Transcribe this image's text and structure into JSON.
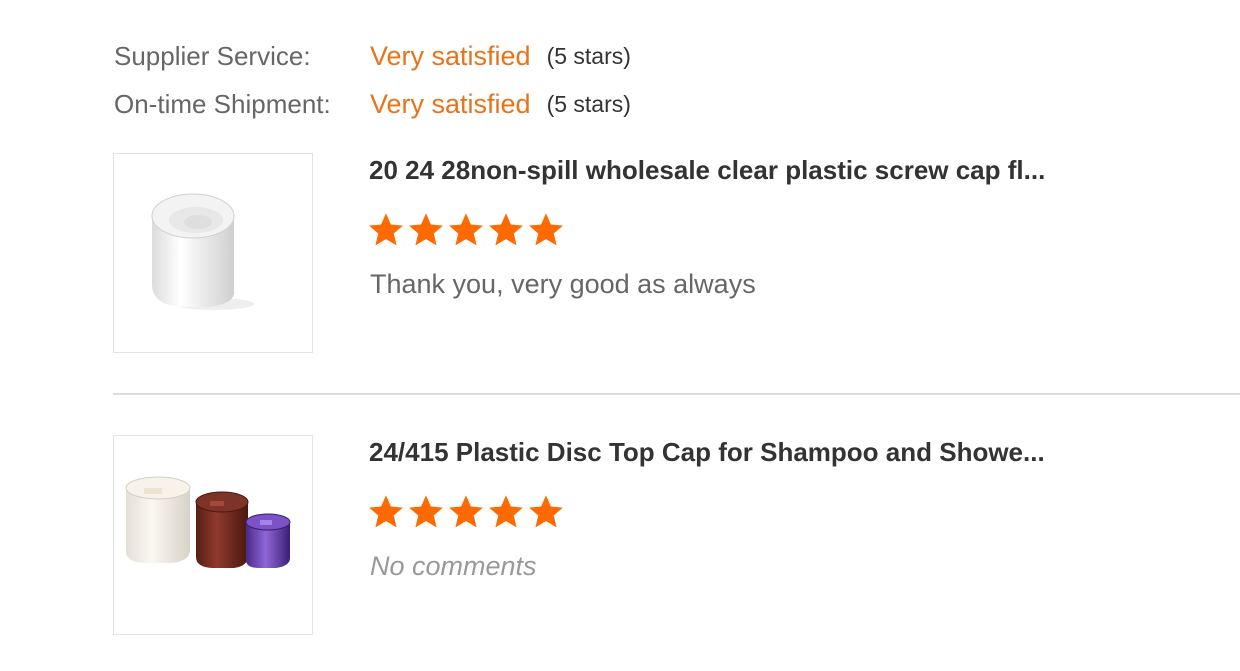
{
  "ratings_summary": {
    "supplier_service": {
      "label": "Supplier Service:",
      "value": "Very satisfied",
      "stars": "(5 stars)"
    },
    "ontime_shipment": {
      "label": "On-time Shipment:",
      "value": "Very satisfied",
      "stars": "(5 stars)"
    }
  },
  "colors": {
    "accent": "#e8731b",
    "star": "#ff6a00",
    "divider": "#dddddd"
  },
  "reviews": [
    {
      "title": "20 24 28non-spill wholesale clear plastic screw cap fl...",
      "rating": 5,
      "comment": "Thank you, very good as always",
      "image_icon": "white-flip-cap-image"
    },
    {
      "title": "24/415 Plastic Disc Top Cap for Shampoo and Showe...",
      "rating": 5,
      "comment": "No comments",
      "image_icon": "three-disc-top-caps-image"
    }
  ]
}
